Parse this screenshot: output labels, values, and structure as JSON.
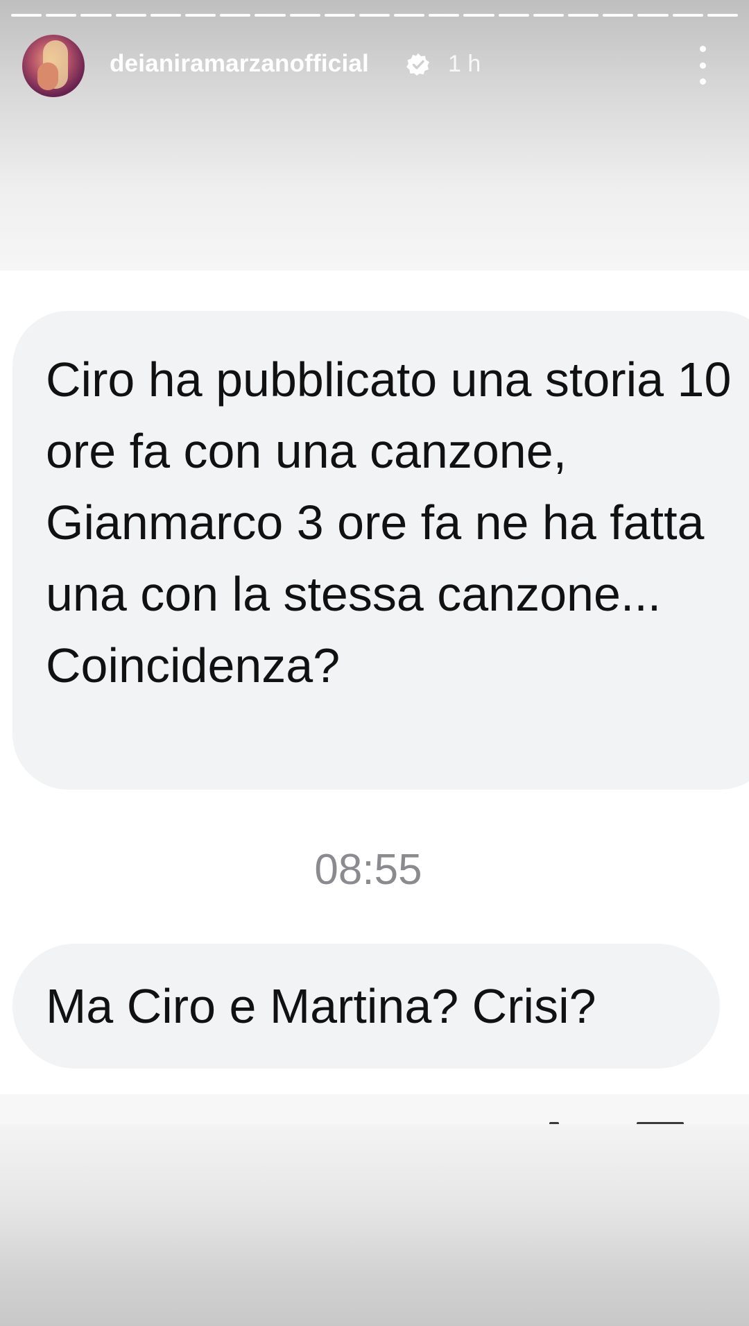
{
  "story": {
    "progress_segments": 21,
    "header": {
      "username": "deianiramarzanofficial",
      "verified_icon": "verified-badge-icon",
      "time": "1 h",
      "menu_icon": "more-vertical-icon"
    }
  },
  "chat": {
    "messages": [
      {
        "text": "Ciro ha pubblicato una storia 10 ore fa con una canzone, Gianmarco 3 ore fa ne ha fatta una con la stessa canzone... Coincidenza?"
      },
      {
        "text": "Ma Ciro e Martina? Crisi?"
      }
    ],
    "timestamp": "08:55"
  },
  "colors": {
    "bubble_bg": "#f2f3f5",
    "timestamp": "#8b8b8f",
    "text": "#111111"
  }
}
